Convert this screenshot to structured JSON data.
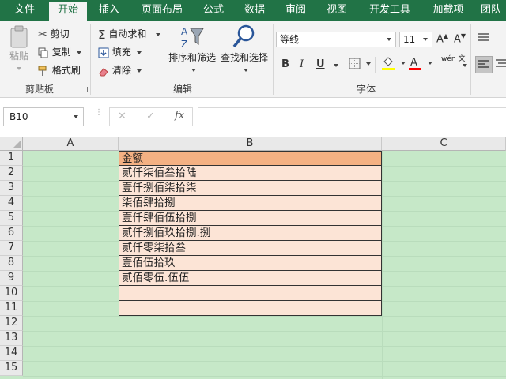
{
  "ribbon_tabs": [
    "文件",
    "开始",
    "插入",
    "页面布局",
    "公式",
    "数据",
    "审阅",
    "视图",
    "开发工具",
    "加载项",
    "团队"
  ],
  "active_tab": "开始",
  "clipboard": {
    "paste": "粘贴",
    "cut": "剪切",
    "copy": "复制",
    "format_painter": "格式刷",
    "group": "剪贴板"
  },
  "editing": {
    "autosum": "自动求和",
    "fill": "填充",
    "clear": "清除",
    "sort_filter": "排序和筛选",
    "find_select": "查找和选择",
    "group": "编辑"
  },
  "font": {
    "name": "等线",
    "size": "11",
    "group": "字体",
    "bold": "B",
    "italic": "I",
    "underline": "U",
    "phonetic": "wén 文"
  },
  "formula_bar": {
    "name_box": "B10",
    "fx": "fx",
    "cancel": "✕",
    "enter": "✓",
    "formula": ""
  },
  "sheet": {
    "columns": [
      "A",
      "B",
      "C"
    ],
    "rows": [
      "1",
      "2",
      "3",
      "4",
      "5",
      "6",
      "7",
      "8",
      "9",
      "10",
      "11",
      "12",
      "13",
      "14",
      "15"
    ],
    "column_b": [
      "金额",
      "贰仟柒佰叁拾陆",
      "壹仟捌佰柒拾柒",
      "柒佰肆拾捌",
      "壹仟肆佰伍拾捌",
      "贰仟捌佰玖拾捌.捌",
      "贰仟零柒拾叁",
      "壹佰伍拾玖",
      "贰佰零伍.伍伍",
      "",
      ""
    ]
  },
  "colors": {
    "ribbon_green": "#217346",
    "sheet_bg": "#c6e8c8",
    "header_fill": "#f4b183",
    "cell_fill": "#fce4d6",
    "highlight_yellow": "#ffff00",
    "font_red": "#ff0000"
  }
}
